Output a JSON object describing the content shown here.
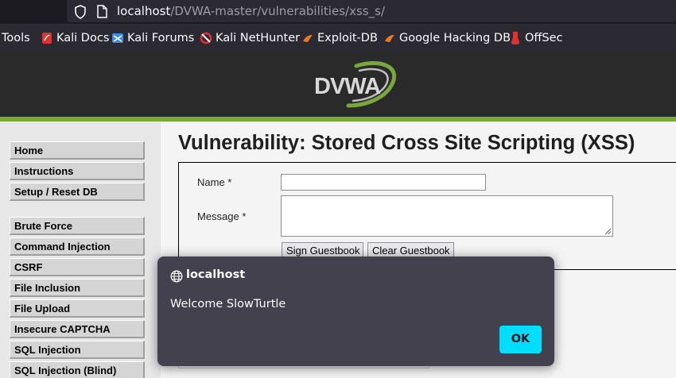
{
  "browser": {
    "url_host": "localhost",
    "url_path": "/DVWA-master/vulnerabilities/xss_s/",
    "bookmarks": [
      {
        "label": "Tools",
        "icon": "none"
      },
      {
        "label": "Kali Docs",
        "icon": "kali-docs-icon"
      },
      {
        "label": "Kali Forums",
        "icon": "kali-forums-icon"
      },
      {
        "label": "Kali NetHunter",
        "icon": "kali-nethunter-icon"
      },
      {
        "label": "Exploit-DB",
        "icon": "exploit-db-icon"
      },
      {
        "label": "Google Hacking DB",
        "icon": "google-hacking-db-icon"
      },
      {
        "label": "OffSec",
        "icon": "offsec-icon"
      }
    ]
  },
  "header": {
    "logo_text": "DVWA"
  },
  "sidebar": {
    "items": [
      {
        "label": "Home"
      },
      {
        "label": "Instructions"
      },
      {
        "label": "Setup / Reset DB"
      },
      {
        "label": "Brute Force"
      },
      {
        "label": "Command Injection"
      },
      {
        "label": "CSRF"
      },
      {
        "label": "File Inclusion"
      },
      {
        "label": "File Upload"
      },
      {
        "label": "Insecure CAPTCHA"
      },
      {
        "label": "SQL Injection"
      },
      {
        "label": "SQL Injection (Blind)"
      }
    ]
  },
  "main": {
    "title": "Vulnerability: Stored Cross Site Scripting (XSS)",
    "form": {
      "name_label": "Name *",
      "name_value": "",
      "message_label": "Message *",
      "message_value": "",
      "sign_button": "Sign Guestbook",
      "clear_button": "Clear Guestbook"
    }
  },
  "dialog": {
    "origin": "localhost",
    "message": "Welcome SlowTurtle",
    "ok_label": "OK"
  },
  "colors": {
    "header_bg": "#2a2a2a",
    "accent_green": "#78a83c",
    "dialog_bg": "#42414d",
    "ok_button": "#00ddff"
  }
}
